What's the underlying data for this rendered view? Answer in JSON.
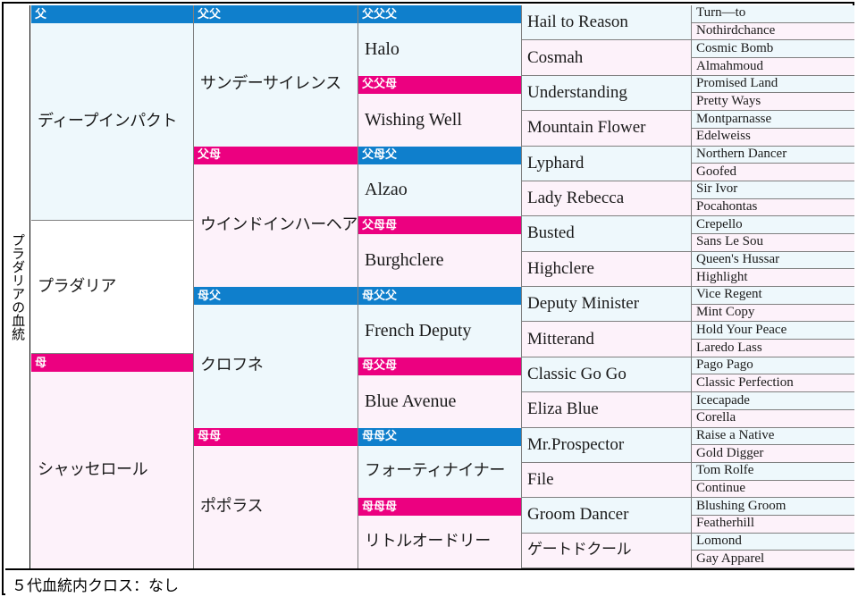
{
  "title_vertical": "プラダリアの血統",
  "footer": {
    "text": "５代血統内クロス：なし"
  },
  "labels": {
    "sire": "父",
    "dam": "母",
    "sire_sire": "父父",
    "sire_dam": "父母",
    "dam_sire": "母父",
    "dam_dam": "母母",
    "sss": "父父父",
    "ssd": "父父母",
    "sds": "父母父",
    "sdd": "父母母",
    "dss": "母父父",
    "dsd": "母父母",
    "dds": "母母父",
    "ddd": "母母母"
  },
  "colors": {
    "sire_band": "#0f7fcc",
    "dam_band": "#ec0080",
    "sire_fill": "#eef8fc",
    "dam_fill": "#fdf2fa",
    "border": "#808080",
    "frame": "#000000"
  },
  "subject": {
    "name": "プラダリア"
  },
  "generation1": [
    {
      "name": "ディープインパクト",
      "sex": "sire"
    },
    {
      "name": "シャッセロール",
      "sex": "dam"
    }
  ],
  "generation2": [
    {
      "name": "サンデーサイレンス",
      "sex": "sire"
    },
    {
      "name": "ウインドインハーヘア",
      "sex": "dam"
    },
    {
      "name": "クロフネ",
      "sex": "sire"
    },
    {
      "name": "ポポラス",
      "sex": "dam"
    }
  ],
  "generation3": [
    {
      "name": "Halo",
      "sex": "sire"
    },
    {
      "name": "Wishing Well",
      "sex": "dam"
    },
    {
      "name": "Alzao",
      "sex": "sire"
    },
    {
      "name": "Burghclere",
      "sex": "dam"
    },
    {
      "name": "French Deputy",
      "sex": "sire"
    },
    {
      "name": "Blue Avenue",
      "sex": "dam"
    },
    {
      "name": "フォーティナイナー",
      "sex": "sire"
    },
    {
      "name": "リトルオードリー",
      "sex": "dam"
    }
  ],
  "generation4": [
    {
      "name": "Hail to Reason",
      "sex": "sire"
    },
    {
      "name": "Cosmah",
      "sex": "dam"
    },
    {
      "name": "Understanding",
      "sex": "sire"
    },
    {
      "name": "Mountain Flower",
      "sex": "dam"
    },
    {
      "name": "Lyphard",
      "sex": "sire"
    },
    {
      "name": "Lady Rebecca",
      "sex": "dam"
    },
    {
      "name": "Busted",
      "sex": "sire"
    },
    {
      "name": "Highclere",
      "sex": "dam"
    },
    {
      "name": "Deputy Minister",
      "sex": "sire"
    },
    {
      "name": "Mitterand",
      "sex": "dam"
    },
    {
      "name": "Classic Go Go",
      "sex": "sire"
    },
    {
      "name": "Eliza Blue",
      "sex": "dam"
    },
    {
      "name": "Mr.Prospector",
      "sex": "sire"
    },
    {
      "name": "File",
      "sex": "dam"
    },
    {
      "name": "Groom Dancer",
      "sex": "sire"
    },
    {
      "name": "ゲートドクール",
      "sex": "dam"
    }
  ],
  "generation5": [
    {
      "name": "Turn—to",
      "sex": "sire"
    },
    {
      "name": "Nothirdchance",
      "sex": "dam"
    },
    {
      "name": "Cosmic Bomb",
      "sex": "sire"
    },
    {
      "name": "Almahmoud",
      "sex": "dam"
    },
    {
      "name": "Promised Land",
      "sex": "sire"
    },
    {
      "name": "Pretty Ways",
      "sex": "dam"
    },
    {
      "name": "Montparnasse",
      "sex": "sire"
    },
    {
      "name": "Edelweiss",
      "sex": "dam"
    },
    {
      "name": "Northern Dancer",
      "sex": "sire"
    },
    {
      "name": "Goofed",
      "sex": "dam"
    },
    {
      "name": "Sir Ivor",
      "sex": "sire"
    },
    {
      "name": "Pocahontas",
      "sex": "dam"
    },
    {
      "name": "Crepello",
      "sex": "sire"
    },
    {
      "name": "Sans Le Sou",
      "sex": "dam"
    },
    {
      "name": "Queen's Hussar",
      "sex": "sire"
    },
    {
      "name": "Highlight",
      "sex": "dam"
    },
    {
      "name": "Vice Regent",
      "sex": "sire"
    },
    {
      "name": "Mint Copy",
      "sex": "dam"
    },
    {
      "name": "Hold Your Peace",
      "sex": "sire"
    },
    {
      "name": "Laredo Lass",
      "sex": "dam"
    },
    {
      "name": "Pago Pago",
      "sex": "sire"
    },
    {
      "name": "Classic Perfection",
      "sex": "dam"
    },
    {
      "name": "Icecapade",
      "sex": "sire"
    },
    {
      "name": "Corella",
      "sex": "dam"
    },
    {
      "name": "Raise a Native",
      "sex": "sire"
    },
    {
      "name": "Gold Digger",
      "sex": "dam"
    },
    {
      "name": "Tom Rolfe",
      "sex": "sire"
    },
    {
      "name": "Continue",
      "sex": "dam"
    },
    {
      "name": "Blushing Groom",
      "sex": "sire"
    },
    {
      "name": "Featherhill",
      "sex": "dam"
    },
    {
      "name": "Lomond",
      "sex": "sire"
    },
    {
      "name": "Gay Apparel",
      "sex": "dam"
    }
  ]
}
